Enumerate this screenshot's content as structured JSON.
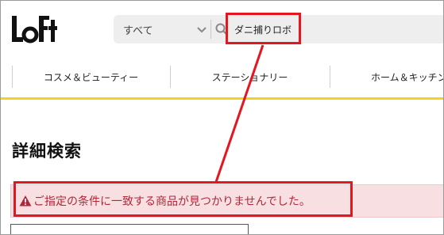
{
  "header": {
    "logo_text": "LoFt",
    "search": {
      "scope_label": "すべて",
      "query": "ダニ捕りロボ"
    }
  },
  "nav": {
    "items": [
      {
        "label": "コスメ＆ビューティー"
      },
      {
        "label": "ステーショナリー"
      },
      {
        "label": "ホーム＆キッチン"
      }
    ]
  },
  "main": {
    "page_title": "詳細検索",
    "alert_message": "ご指定の条件に一致する商品が見つかりませんでした。"
  },
  "colors": {
    "accent_yellow": "#f2d21b",
    "alert_bg": "#f8e0e2",
    "alert_text": "#b0283a",
    "annotation_red": "#e5161f"
  },
  "icons": {
    "scope": "chevron-down-icon",
    "search": "search-icon",
    "alert": "warning-icon"
  }
}
